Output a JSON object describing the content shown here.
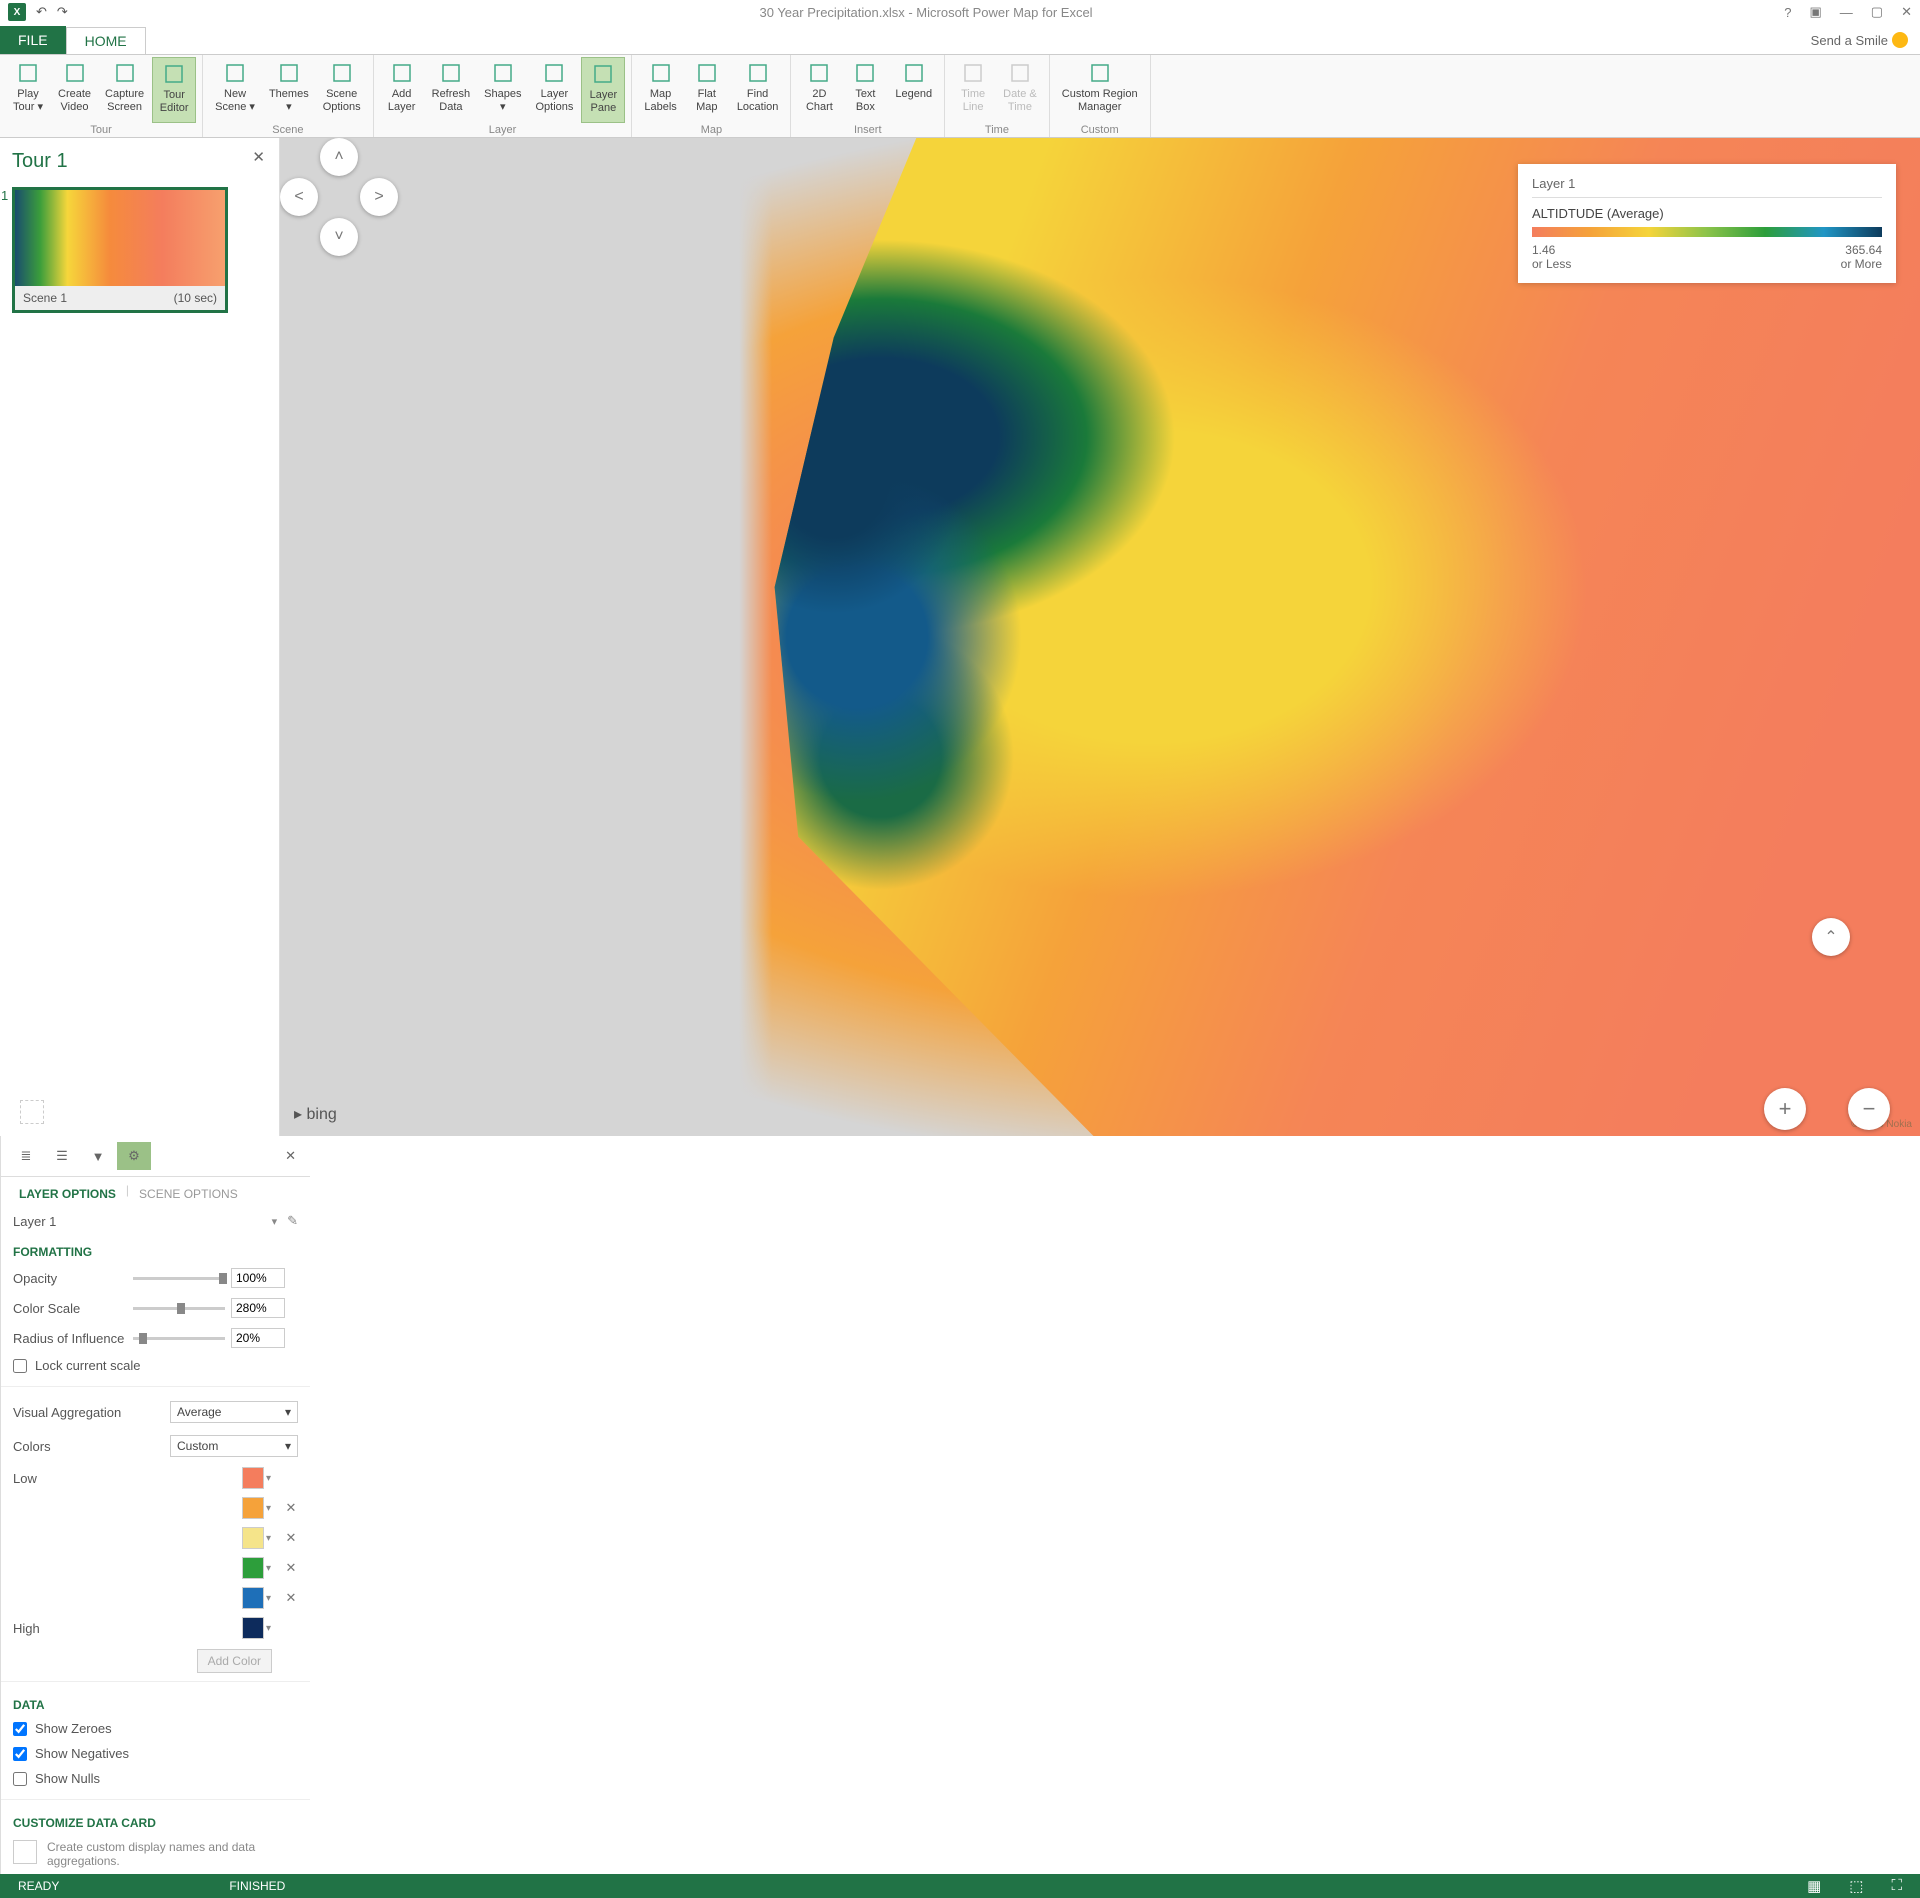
{
  "title": "30 Year Precipitation.xlsx - Microsoft Power Map for Excel",
  "tabs": {
    "file": "FILE",
    "home": "HOME"
  },
  "smile": "Send a Smile",
  "ribbon": {
    "groups": [
      {
        "label": "Tour",
        "buttons": [
          {
            "l1": "Play",
            "l2": "Tour ▾"
          },
          {
            "l1": "Create",
            "l2": "Video"
          },
          {
            "l1": "Capture",
            "l2": "Screen"
          },
          {
            "l1": "Tour",
            "l2": "Editor",
            "active": true
          }
        ]
      },
      {
        "label": "Scene",
        "buttons": [
          {
            "l1": "New",
            "l2": "Scene ▾"
          },
          {
            "l1": "Themes",
            "l2": "▾"
          },
          {
            "l1": "Scene",
            "l2": "Options"
          }
        ]
      },
      {
        "label": "Layer",
        "buttons": [
          {
            "l1": "Add",
            "l2": "Layer"
          },
          {
            "l1": "Refresh",
            "l2": "Data"
          },
          {
            "l1": "Shapes",
            "l2": "▾"
          },
          {
            "l1": "Layer",
            "l2": "Options"
          },
          {
            "l1": "Layer",
            "l2": "Pane",
            "active": true
          }
        ]
      },
      {
        "label": "Map",
        "buttons": [
          {
            "l1": "Map",
            "l2": "Labels"
          },
          {
            "l1": "Flat",
            "l2": "Map"
          },
          {
            "l1": "Find",
            "l2": "Location"
          }
        ]
      },
      {
        "label": "Insert",
        "buttons": [
          {
            "l1": "2D",
            "l2": "Chart"
          },
          {
            "l1": "Text",
            "l2": "Box"
          },
          {
            "l1": "Legend",
            "l2": ""
          }
        ]
      },
      {
        "label": "Time",
        "buttons": [
          {
            "l1": "Time",
            "l2": "Line",
            "disabled": true
          },
          {
            "l1": "Date &",
            "l2": "Time",
            "disabled": true
          }
        ]
      },
      {
        "label": "Custom",
        "buttons": [
          {
            "l1": "Custom Region",
            "l2": "Manager"
          }
        ]
      }
    ]
  },
  "tour": {
    "title": "Tour 1",
    "scene_num": "1",
    "scene_name": "Scene 1",
    "scene_time": "(10 sec)"
  },
  "legend": {
    "layer": "Layer 1",
    "metric": "ALTIDTUDE (Average)",
    "low_val": "1.46",
    "low_lbl": "or Less",
    "high_val": "365.64",
    "high_lbl": "or More"
  },
  "bing": "bing",
  "copyright": "© 2015 Nokia",
  "rp": {
    "tab1": "LAYER OPTIONS",
    "tab2": "SCENE OPTIONS",
    "layer": "Layer 1",
    "formatting": "FORMATTING",
    "opacity": "Opacity",
    "opacity_v": "100%",
    "colorscale": "Color Scale",
    "colorscale_v": "280%",
    "radius": "Radius of Influence",
    "radius_v": "20%",
    "lock": "Lock current scale",
    "vagg": "Visual Aggregation",
    "vagg_v": "Average",
    "colors": "Colors",
    "colors_v": "Custom",
    "low": "Low",
    "high": "High",
    "swatches": [
      "#f47d5d",
      "#f5a23a",
      "#f5e48a",
      "#2d9e3b",
      "#1e6fb8",
      "#0d2b5c"
    ],
    "addcolor": "Add Color",
    "data": "DATA",
    "showz": "Show Zeroes",
    "shown": "Show Negatives",
    "shownu": "Show Nulls",
    "cdc": "CUSTOMIZE DATA CARD",
    "cdc_txt": "Create custom display names and data aggregations."
  },
  "status": {
    "ready": "READY",
    "finished": "FINISHED"
  }
}
